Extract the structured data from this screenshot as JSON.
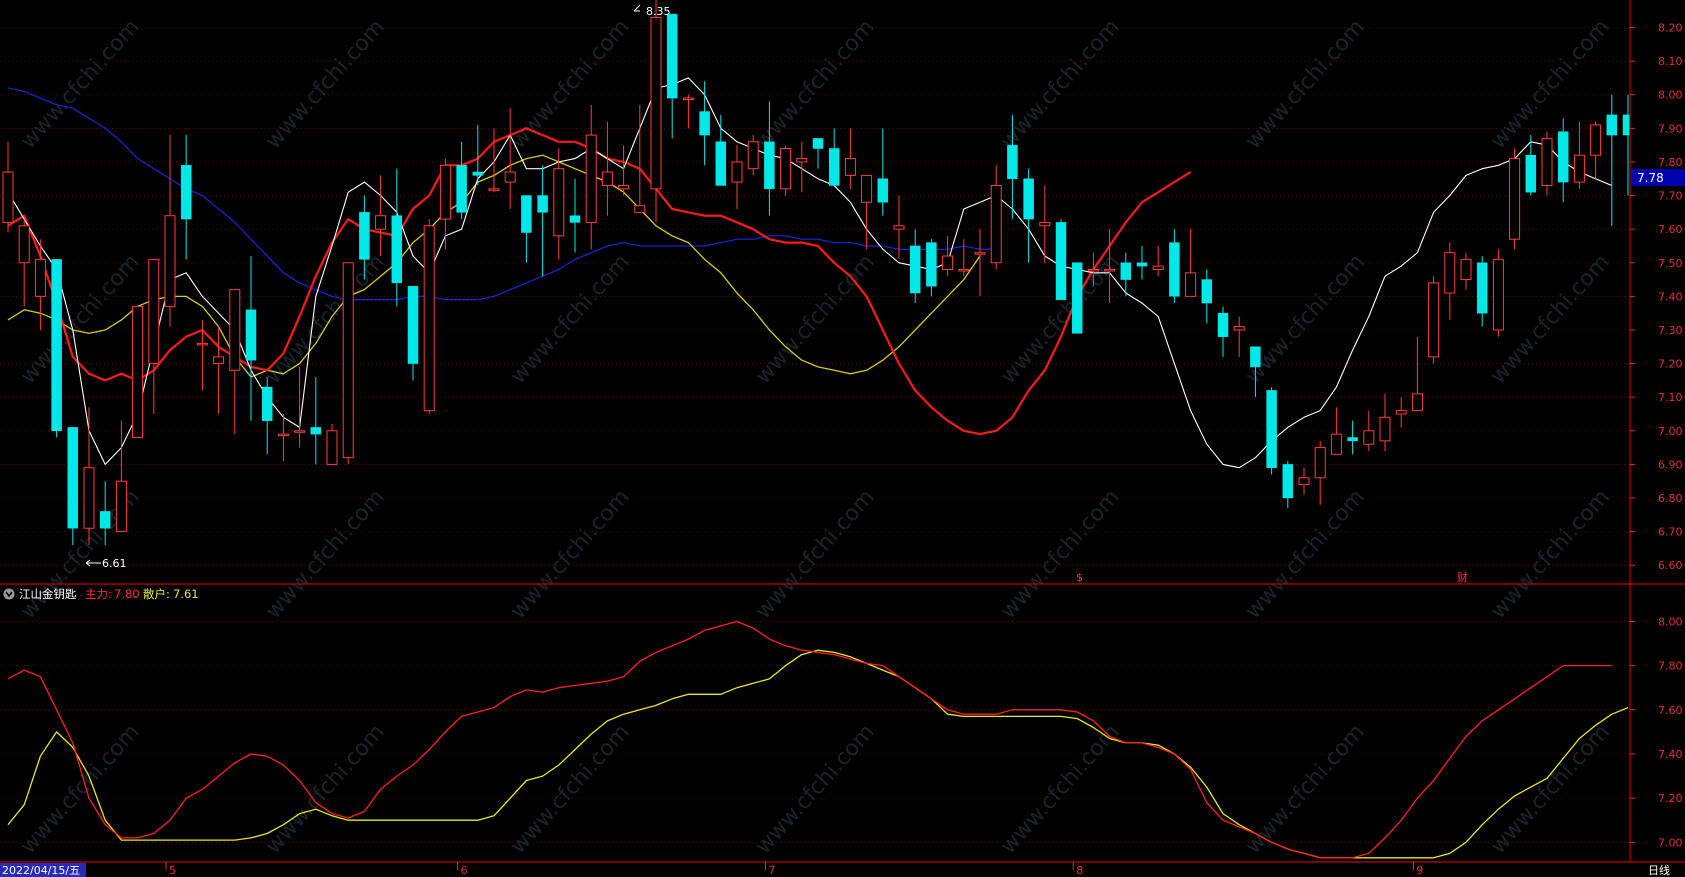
{
  "window": {
    "period_label": "日线",
    "start_date": "2022/04/15/五"
  },
  "colors": {
    "up": "#ff3b3b",
    "down": "#00e8e8",
    "ma5": "#ffffff",
    "ma10": "#ff1a1a",
    "ma20": "#d4cc22",
    "ma60": "#1a22cc",
    "grid": "#7a0000",
    "axis": "#e03030",
    "current_price_bg": "#0000b0",
    "main_force": "#ff2020",
    "retail": "#e8e820"
  },
  "price_panel": {
    "ylim": [
      6.55,
      8.27
    ],
    "y_ticks": [
      "8.20",
      "8.10",
      "8.00",
      "7.90",
      "7.80",
      "7.70",
      "7.60",
      "7.50",
      "7.40",
      "7.30",
      "7.20",
      "7.10",
      "7.00",
      "6.90",
      "6.80",
      "6.70",
      "6.60"
    ],
    "current_price": "7.78",
    "annotations": {
      "high": "8.35",
      "low": "6.61"
    },
    "markers": {
      "dividend": "$",
      "finance": "财"
    }
  },
  "indicator_panel": {
    "name": "江山金钥匙",
    "main_label": "主力:",
    "main_value": "7.80",
    "retail_label": "散户:",
    "retail_value": "7.61",
    "ylim": [
      6.92,
      8.07
    ],
    "y_ticks": [
      "8.00",
      "7.80",
      "7.60",
      "7.40",
      "7.20",
      "7.00"
    ]
  },
  "x_axis": {
    "month_labels": [
      "5",
      "6",
      "7",
      "8",
      "9"
    ]
  },
  "chart_data": {
    "type": "candlestick",
    "candles": [
      [
        7.62,
        7.77,
        7.86,
        7.59
      ],
      [
        7.5,
        7.61,
        7.63,
        7.37
      ],
      [
        7.4,
        7.51,
        7.57,
        7.3
      ],
      [
        7.51,
        7.0,
        7.51,
        6.98
      ],
      [
        7.01,
        6.71,
        7.01,
        6.66
      ],
      [
        6.71,
        6.89,
        7.07,
        6.66
      ],
      [
        6.76,
        6.71,
        6.85,
        6.66
      ],
      [
        6.7,
        6.85,
        7.03,
        6.7
      ],
      [
        6.98,
        7.37,
        7.37,
        6.98
      ],
      [
        7.2,
        7.51,
        7.51,
        7.05
      ],
      [
        7.37,
        7.64,
        7.88,
        7.31
      ],
      [
        7.79,
        7.63,
        7.88,
        7.51
      ],
      [
        7.26,
        7.26,
        7.33,
        7.12
      ],
      [
        7.2,
        7.22,
        7.31,
        7.05
      ],
      [
        7.18,
        7.42,
        7.42,
        6.99
      ],
      [
        7.36,
        7.21,
        7.52,
        7.03
      ],
      [
        7.13,
        7.03,
        7.16,
        6.93
      ],
      [
        6.99,
        6.99,
        7.05,
        6.91
      ],
      [
        7.0,
        7.0,
        7.19,
        6.95
      ],
      [
        7.01,
        6.99,
        7.16,
        6.9
      ],
      [
        6.9,
        7.0,
        7.02,
        6.92
      ],
      [
        6.92,
        7.5,
        7.49,
        6.9
      ],
      [
        7.65,
        7.51,
        7.7,
        7.45
      ],
      [
        7.6,
        7.64,
        7.76,
        7.52
      ],
      [
        7.64,
        7.44,
        7.78,
        7.37
      ],
      [
        7.43,
        7.2,
        7.43,
        7.15
      ],
      [
        7.06,
        7.61,
        7.63,
        7.05
      ],
      [
        7.63,
        7.79,
        7.81,
        7.54
      ],
      [
        7.79,
        7.65,
        7.86,
        7.63
      ],
      [
        7.77,
        7.76,
        7.91,
        7.73
      ],
      [
        7.72,
        7.72,
        7.9,
        7.71
      ],
      [
        7.74,
        7.77,
        7.96,
        7.66
      ],
      [
        7.7,
        7.59,
        7.7,
        7.5
      ],
      [
        7.7,
        7.65,
        7.79,
        7.46
      ],
      [
        7.58,
        7.78,
        7.84,
        7.51
      ],
      [
        7.64,
        7.62,
        7.75,
        7.53
      ],
      [
        7.62,
        7.88,
        7.97,
        7.54
      ],
      [
        7.73,
        7.77,
        7.92,
        7.64
      ],
      [
        7.72,
        7.73,
        7.85,
        7.7
      ],
      [
        7.65,
        7.67,
        7.97,
        7.65
      ],
      [
        7.72,
        8.23,
        8.34,
        7.62
      ],
      [
        8.24,
        7.99,
        8.24,
        7.87
      ],
      [
        7.99,
        7.99,
        8.0,
        7.9
      ],
      [
        7.95,
        7.88,
        8.04,
        7.79
      ],
      [
        7.86,
        7.73,
        7.94,
        7.73
      ],
      [
        7.74,
        7.8,
        7.85,
        7.66
      ],
      [
        7.78,
        7.86,
        7.88,
        7.76
      ],
      [
        7.86,
        7.72,
        7.98,
        7.64
      ],
      [
        7.72,
        7.84,
        7.85,
        7.7
      ],
      [
        7.8,
        7.81,
        7.86,
        7.71
      ],
      [
        7.87,
        7.84,
        7.87,
        7.78
      ],
      [
        7.84,
        7.73,
        7.9,
        7.75
      ],
      [
        7.76,
        7.81,
        7.9,
        7.72
      ],
      [
        7.68,
        7.76,
        7.75,
        7.54
      ],
      [
        7.75,
        7.68,
        7.9,
        7.64
      ],
      [
        7.6,
        7.61,
        7.7,
        7.51
      ],
      [
        7.55,
        7.41,
        7.6,
        7.38
      ],
      [
        7.56,
        7.43,
        7.57,
        7.4
      ],
      [
        7.48,
        7.52,
        7.58,
        7.46
      ],
      [
        7.48,
        7.48,
        7.57,
        7.46
      ],
      [
        7.53,
        7.53,
        7.6,
        7.4
      ],
      [
        7.5,
        7.73,
        7.79,
        7.48
      ],
      [
        7.85,
        7.75,
        7.94,
        7.63
      ],
      [
        7.75,
        7.63,
        7.78,
        7.5
      ],
      [
        7.61,
        7.62,
        7.73,
        7.5
      ],
      [
        7.62,
        7.39,
        7.63,
        7.39
      ],
      [
        7.5,
        7.29,
        7.5,
        7.29
      ],
      [
        7.48,
        7.48,
        7.53,
        7.43
      ],
      [
        7.48,
        7.48,
        7.6,
        7.38
      ],
      [
        7.5,
        7.45,
        7.53,
        7.4
      ],
      [
        7.5,
        7.49,
        7.55,
        7.45
      ],
      [
        7.48,
        7.49,
        7.55,
        7.46
      ],
      [
        7.56,
        7.4,
        7.6,
        7.38
      ],
      [
        7.4,
        7.47,
        7.6,
        7.44
      ],
      [
        7.45,
        7.38,
        7.48,
        7.32
      ],
      [
        7.35,
        7.28,
        7.37,
        7.22
      ],
      [
        7.3,
        7.31,
        7.34,
        7.22
      ],
      [
        7.25,
        7.19,
        7.25,
        7.1
      ],
      [
        7.12,
        6.89,
        7.13,
        6.87
      ],
      [
        6.9,
        6.8,
        6.91,
        6.77
      ],
      [
        6.84,
        6.86,
        6.89,
        6.81
      ],
      [
        6.86,
        6.95,
        6.97,
        6.78
      ],
      [
        6.93,
        6.99,
        7.07,
        6.93
      ],
      [
        6.98,
        6.97,
        7.03,
        6.93
      ],
      [
        6.96,
        7.0,
        7.06,
        6.94
      ],
      [
        6.97,
        7.04,
        7.11,
        6.94
      ],
      [
        7.05,
        7.06,
        7.1,
        7.01
      ],
      [
        7.06,
        7.11,
        7.28,
        7.06
      ],
      [
        7.22,
        7.44,
        7.46,
        7.2
      ],
      [
        7.41,
        7.53,
        7.56,
        7.33
      ],
      [
        7.45,
        7.51,
        7.53,
        7.42
      ],
      [
        7.5,
        7.35,
        7.52,
        7.31
      ],
      [
        7.3,
        7.51,
        7.54,
        7.28
      ],
      [
        7.57,
        7.81,
        7.84,
        7.54
      ],
      [
        7.82,
        7.71,
        7.88,
        7.7
      ],
      [
        7.73,
        7.87,
        7.89,
        7.7
      ],
      [
        7.89,
        7.74,
        7.93,
        7.68
      ],
      [
        7.74,
        7.82,
        7.92,
        7.72
      ],
      [
        7.82,
        7.91,
        7.92,
        7.75
      ],
      [
        7.94,
        7.88,
        8.0,
        7.61
      ],
      [
        7.94,
        7.88,
        8.0,
        7.7
      ],
      [
        7.77,
        7.69,
        7.81,
        7.67
      ],
      [
        7.71,
        7.71,
        7.78,
        7.66
      ],
      [
        7.7,
        7.63,
        7.75,
        7.61
      ],
      [
        7.72,
        7.8,
        7.81,
        7.65
      ],
      [
        7.67,
        7.9,
        7.91,
        7.66
      ]
    ],
    "ma5": [
      7.71,
      7.63,
      7.55,
      7.48,
      7.3,
      7.0,
      6.9,
      6.95,
      7.05,
      7.25,
      7.45,
      7.47,
      7.4,
      7.35,
      7.3,
      7.18,
      7.1,
      7.04,
      7.01,
      7.4,
      7.55,
      7.71,
      7.74,
      7.7,
      7.65,
      7.52,
      7.47,
      7.58,
      7.6,
      7.75,
      7.8,
      7.88,
      7.78,
      7.78,
      7.8,
      7.81,
      7.84,
      7.81,
      7.78,
      7.9,
      8.02,
      8.03,
      8.05,
      8.0,
      7.9,
      7.86,
      7.84,
      7.82,
      7.81,
      7.78,
      7.75,
      7.73,
      7.68,
      7.6,
      7.54,
      7.5,
      7.49,
      7.48,
      7.5,
      7.66,
      7.68,
      7.7,
      7.66,
      7.6,
      7.52,
      7.49,
      7.48,
      7.47,
      7.47,
      7.41,
      7.38,
      7.34,
      7.2,
      7.06,
      6.96,
      6.9,
      6.89,
      6.92,
      6.97,
      7.01,
      7.04,
      7.06,
      7.13,
      7.24,
      7.34,
      7.46,
      7.49,
      7.53,
      7.65,
      7.7,
      7.76,
      7.78,
      7.79,
      7.81,
      7.86,
      7.85,
      7.8,
      7.77,
      7.75,
      7.73
    ],
    "ma10": [
      7.61,
      7.64,
      7.52,
      7.38,
      7.22,
      7.17,
      7.15,
      7.17,
      7.15,
      7.18,
      7.24,
      7.28,
      7.3,
      7.25,
      7.22,
      7.19,
      7.18,
      7.23,
      7.34,
      7.46,
      7.56,
      7.63,
      7.6,
      7.59,
      7.58,
      7.66,
      7.7,
      7.79,
      7.79,
      7.81,
      7.86,
      7.88,
      7.9,
      7.88,
      7.86,
      7.86,
      7.84,
      7.81,
      7.8,
      7.78,
      7.72,
      7.66,
      7.65,
      7.64,
      7.64,
      7.62,
      7.6,
      7.57,
      7.56,
      7.56,
      7.55,
      7.5,
      7.46,
      7.4,
      7.3,
      7.2,
      7.12,
      7.07,
      7.03,
      7.0,
      6.99,
      7.0,
      7.04,
      7.12,
      7.18,
      7.28,
      7.4,
      7.48,
      7.55,
      7.62,
      7.68,
      7.71,
      7.74,
      7.77
    ],
    "ma20": [
      7.33,
      7.36,
      7.35,
      7.33,
      7.3,
      7.29,
      7.3,
      7.33,
      7.37,
      7.39,
      7.4,
      7.4,
      7.37,
      7.31,
      7.22,
      7.16,
      7.18,
      7.17,
      7.2,
      7.26,
      7.34,
      7.4,
      7.42,
      7.46,
      7.5,
      7.56,
      7.6,
      7.65,
      7.68,
      7.74,
      7.76,
      7.79,
      7.81,
      7.82,
      7.8,
      7.78,
      7.76,
      7.74,
      7.71,
      7.66,
      7.61,
      7.58,
      7.56,
      7.51,
      7.47,
      7.41,
      7.36,
      7.3,
      7.25,
      7.21,
      7.19,
      7.18,
      7.17,
      7.18,
      7.21,
      7.25,
      7.3,
      7.35,
      7.4,
      7.45,
      7.52
    ],
    "ma60": [
      8.02,
      8.01,
      7.99,
      7.97,
      7.96,
      7.93,
      7.9,
      7.86,
      7.81,
      7.78,
      7.75,
      7.72,
      7.7,
      7.66,
      7.62,
      7.57,
      7.52,
      7.47,
      7.44,
      7.42,
      7.4,
      7.39,
      7.39,
      7.39,
      7.39,
      7.4,
      7.4,
      7.39,
      7.39,
      7.39,
      7.4,
      7.42,
      7.44,
      7.46,
      7.48,
      7.51,
      7.53,
      7.55,
      7.56,
      7.55,
      7.55,
      7.55,
      7.55,
      7.55,
      7.56,
      7.57,
      7.57,
      7.58,
      7.58,
      7.57,
      7.57,
      7.56,
      7.56,
      7.55,
      7.55,
      7.54,
      7.54,
      7.54,
      7.54,
      7.55,
      7.54,
      7.54
    ],
    "main_force": [
      7.74,
      7.78,
      7.75,
      7.6,
      7.45,
      7.2,
      7.08,
      7.02,
      7.02,
      7.04,
      7.1,
      7.2,
      7.24,
      7.3,
      7.36,
      7.4,
      7.39,
      7.35,
      7.28,
      7.18,
      7.13,
      7.11,
      7.14,
      7.24,
      7.3,
      7.35,
      7.42,
      7.5,
      7.57,
      7.59,
      7.61,
      7.66,
      7.69,
      7.68,
      7.7,
      7.71,
      7.72,
      7.73,
      7.75,
      7.82,
      7.86,
      7.89,
      7.92,
      7.96,
      7.98,
      8.0,
      7.97,
      7.92,
      7.89,
      7.87,
      7.86,
      7.85,
      7.83,
      7.81,
      7.8,
      7.75,
      7.7,
      7.65,
      7.6,
      7.58,
      7.58,
      7.58,
      7.6,
      7.6,
      7.6,
      7.6,
      7.59,
      7.55,
      7.48,
      7.45,
      7.45,
      7.43,
      7.4,
      7.33,
      7.18,
      7.1,
      7.07,
      7.04,
      7.0,
      6.97,
      6.95,
      6.93,
      6.93,
      6.93,
      6.95,
      7.02,
      7.1,
      7.2,
      7.28,
      7.38,
      7.48,
      7.55,
      7.6,
      7.65,
      7.7,
      7.75,
      7.8,
      7.8,
      7.8,
      7.8
    ],
    "retail": [
      7.08,
      7.17,
      7.39,
      7.5,
      7.43,
      7.3,
      7.1,
      7.01,
      7.01,
      7.01,
      7.01,
      7.01,
      7.01,
      7.01,
      7.01,
      7.02,
      7.04,
      7.08,
      7.13,
      7.15,
      7.12,
      7.1,
      7.1,
      7.1,
      7.1,
      7.1,
      7.1,
      7.1,
      7.1,
      7.1,
      7.12,
      7.2,
      7.28,
      7.3,
      7.35,
      7.42,
      7.49,
      7.55,
      7.58,
      7.6,
      7.62,
      7.65,
      7.67,
      7.67,
      7.67,
      7.7,
      7.72,
      7.74,
      7.8,
      7.85,
      7.87,
      7.86,
      7.84,
      7.81,
      7.78,
      7.75,
      7.7,
      7.65,
      7.58,
      7.57,
      7.57,
      7.57,
      7.57,
      7.57,
      7.57,
      7.57,
      7.56,
      7.52,
      7.47,
      7.45,
      7.45,
      7.44,
      7.4,
      7.34,
      7.25,
      7.13,
      7.08,
      7.04,
      7.0,
      6.97,
      6.95,
      6.93,
      6.93,
      6.93,
      6.93,
      6.93,
      6.93,
      6.93,
      6.93,
      6.95,
      7.0,
      7.08,
      7.15,
      7.21,
      7.25,
      7.29,
      7.38,
      7.47,
      7.53,
      7.58,
      7.61
    ]
  }
}
